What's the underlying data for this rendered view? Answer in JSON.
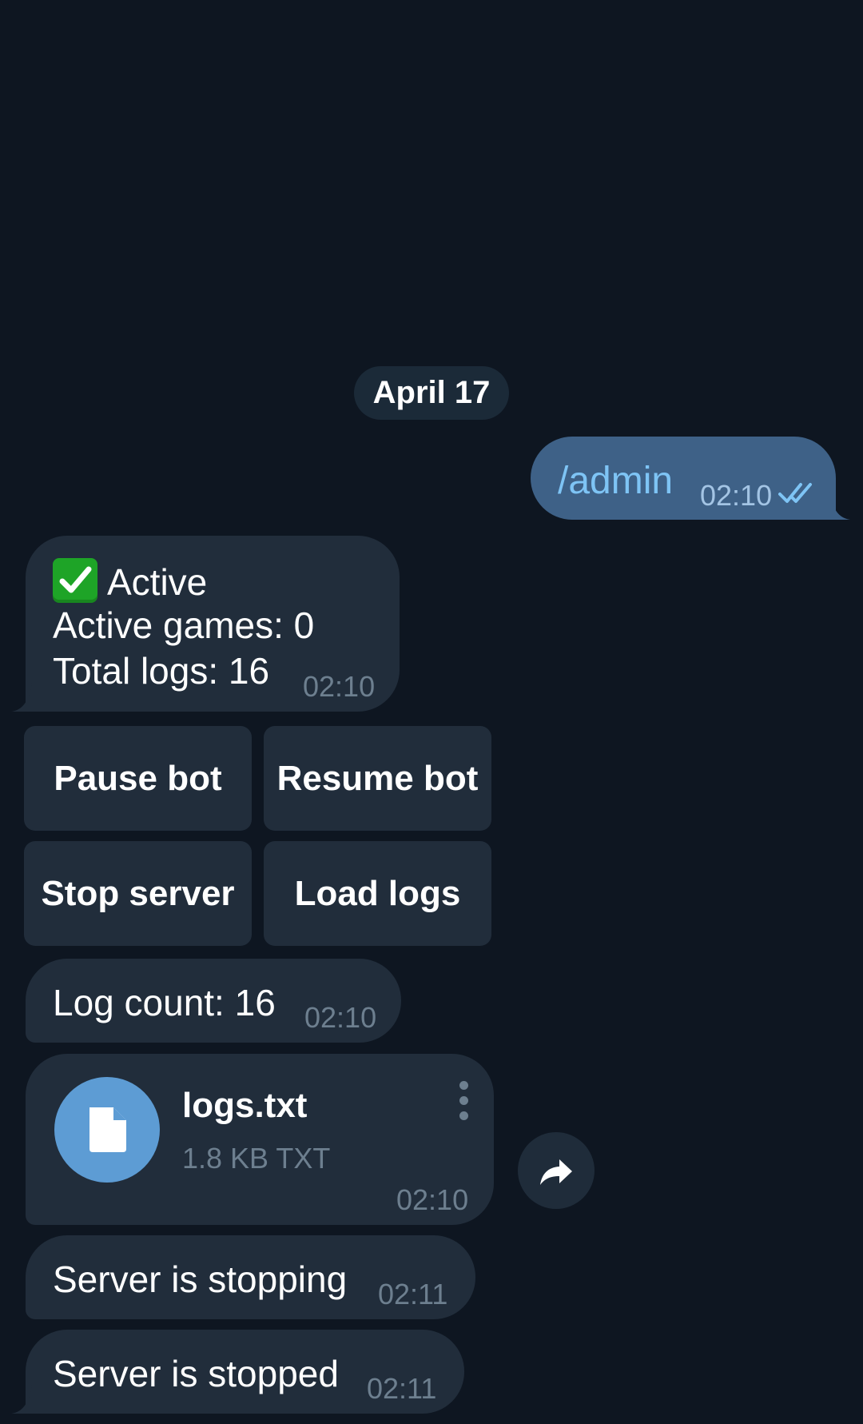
{
  "date_separator": "April 17",
  "outgoing": {
    "text": "/admin",
    "time": "02:10",
    "status": "read"
  },
  "status_message": {
    "emoji": "✅",
    "line1": "Active",
    "line2": "Active games: 0",
    "line3": "Total logs: 16",
    "time": "02:10"
  },
  "keyboard": {
    "pause": "Pause bot",
    "resume": "Resume bot",
    "stop": "Stop server",
    "load": "Load logs"
  },
  "log_count": {
    "text": "Log count: 16",
    "time": "02:10"
  },
  "file": {
    "name": "logs.txt",
    "meta": "1.8 KB TXT",
    "time": "02:10",
    "icon": "file-icon"
  },
  "stopping": {
    "text": "Server is stopping",
    "time": "02:11"
  },
  "stopped": {
    "text": "Server is stopped",
    "time": "02:11"
  },
  "colors": {
    "background": "#0e1621",
    "incoming_bubble": "#212d3b",
    "outgoing_bubble": "#3e6187",
    "accent": "#5d9cd4"
  }
}
